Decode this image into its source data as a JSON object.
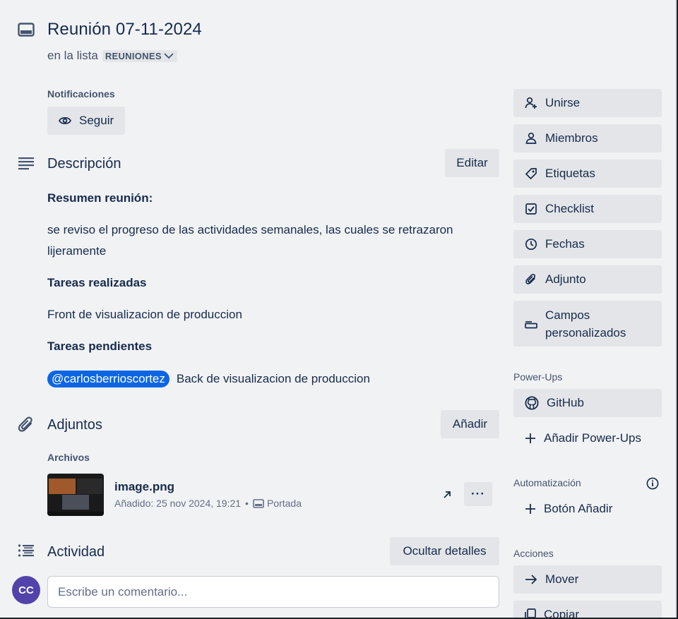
{
  "card": {
    "title": "Reunión 07-11-2024",
    "in_list_prefix": "en la lista",
    "list_name": "REUNIONES"
  },
  "notifications": {
    "label": "Notificaciones",
    "follow_button": "Seguir"
  },
  "description": {
    "title": "Descripción",
    "edit_button": "Editar",
    "summary_heading": "Resumen reunión:",
    "summary_line1": "se reviso el progreso de las actividades semanales, las cuales se retrazaron",
    "summary_line2": "lijeramente",
    "done_heading": "Tareas realizadas",
    "done_item": "Front de visualizacion de produccion",
    "pending_heading": "Tareas pendientes",
    "pending_mention": "@carlosberrioscortez",
    "pending_item": "Back de visualizacion de produccion"
  },
  "attachments": {
    "title": "Adjuntos",
    "add_button": "Añadir",
    "files_label": "Archivos",
    "file": {
      "name": "image.png",
      "added": "Añadido: 25 nov 2024, 19:21",
      "separator": "•",
      "cover_label": "Portada",
      "more_label": "···"
    }
  },
  "activity": {
    "title": "Actividad",
    "hide_details_button": "Ocultar detalles",
    "avatar_initials": "CC",
    "comment_placeholder": "Escribe un comentario..."
  },
  "sidebar": {
    "actions_top": [
      {
        "label": "Unirse",
        "icon": "join-icon"
      },
      {
        "label": "Miembros",
        "icon": "members-icon"
      },
      {
        "label": "Etiquetas",
        "icon": "label-icon"
      },
      {
        "label": "Checklist",
        "icon": "checklist-icon"
      },
      {
        "label": "Fechas",
        "icon": "clock-icon"
      },
      {
        "label": "Adjunto",
        "icon": "paperclip-icon"
      },
      {
        "label_line1": "Campos",
        "label_line2": "personalizados",
        "icon": "custom-fields-icon"
      }
    ],
    "powerups_label": "Power-Ups",
    "github_button": "GitHub",
    "add_powerups_button": "Añadir Power-Ups",
    "automation_label": "Automatización",
    "add_button_button": "Botón Añadir",
    "actions_label": "Acciones",
    "move_button": "Mover",
    "copy_button": "Copiar"
  },
  "colors": {
    "background": "#f1f2f4",
    "button": "#e3e5e8",
    "text": "#172b4d",
    "muted": "#44546f",
    "mention": "#0c66e4",
    "avatar": "#5243aa"
  }
}
